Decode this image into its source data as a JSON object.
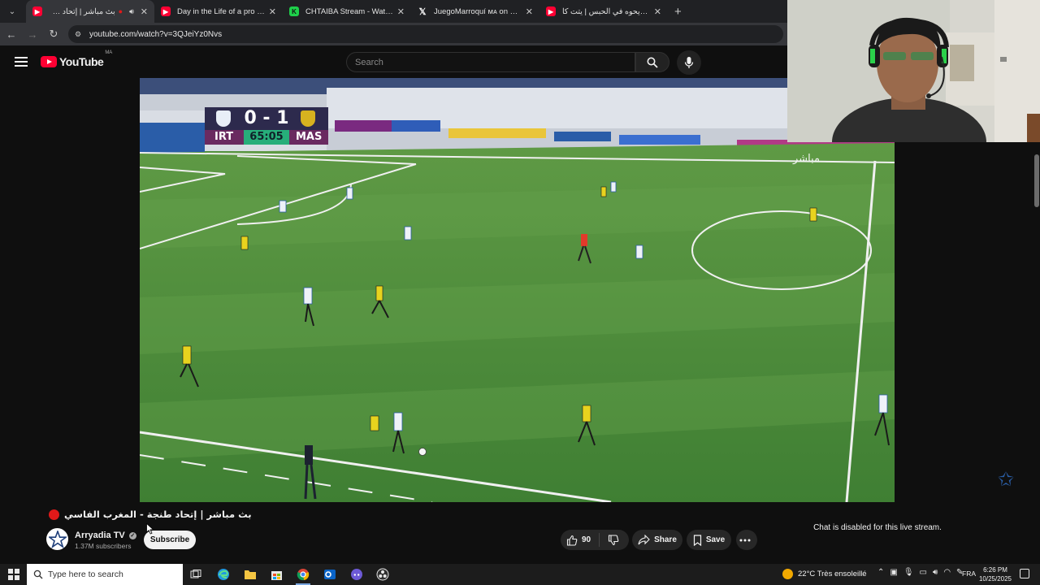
{
  "browser": {
    "tabs": [
      {
        "title": "بث مباشر | إتحاد طنجة - ال",
        "favicon": "youtube",
        "active": true,
        "audio": true,
        "close": "✕"
      },
      {
        "title": "Day in the Life of a pro football",
        "favicon": "youtube",
        "active": false,
        "close": "✕"
      },
      {
        "title": "CHTAIBA Stream - Watch Live",
        "favicon": "chtaiba",
        "active": false,
        "close": "✕"
      },
      {
        "title": "JuegoMarroquí ᴍᴀ on X: \"Azze",
        "favicon": "x",
        "active": false,
        "close": "✕"
      },
      {
        "title": "ديدي ديحوه في الحبس | يتت كا",
        "favicon": "youtube",
        "active": false,
        "close": "✕"
      }
    ],
    "new_tab": "+",
    "url": "youtube.com/watch?v=3QJeiYz0Nvs"
  },
  "youtube": {
    "logo_text": "YouTube",
    "country_code": "MA",
    "search_placeholder": "Search"
  },
  "video": {
    "scoreboard": {
      "home": "IRT",
      "away": "MAS",
      "score": "0 - 1",
      "clock": "65:05"
    },
    "live_overlay": "مباشر",
    "title": "بث مباشر | إتحاد طنجة - المغرب الفاسي",
    "channel": "Arryadia TV",
    "subscribers": "1.37M subscribers",
    "subscribe_label": "Subscribe",
    "likes": "90",
    "share_label": "Share",
    "save_label": "Save"
  },
  "chat": {
    "disabled_text": "Chat is disabled for this live stream."
  },
  "taskbar": {
    "search_placeholder": "Type here to search",
    "weather": "22°C  Très ensoleillé",
    "language": "FRA",
    "time": "6:26 PM",
    "date": "10/25/2025"
  },
  "colors": {
    "youtube_red": "#ff0033",
    "live_red": "#e01919",
    "pitch_green": "#4a8a3a",
    "score_purple": "#2d2a4d",
    "clock_green": "#27ae7a"
  }
}
